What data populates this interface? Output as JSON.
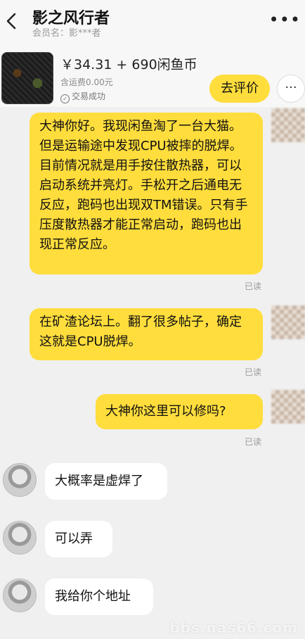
{
  "header": {
    "title": "影之风行者",
    "subtitle": "会员名：影***者"
  },
  "product": {
    "price": "￥34.31 + 690闲鱼币",
    "shipping": "含运费0.00元",
    "status": "交易成功",
    "review_label": "去评价",
    "more_label": "···"
  },
  "messages": [
    {
      "from": "me",
      "text": "大神你好。我现闲鱼淘了一台大猫。但是运输途中发现CPU被摔的脱焊。目前情况就是用手按住散热器，可以启动系统并亮灯。手松开之后通电无反应，跑码也出现双TM错误。只有手压度散热器才能正常启动，跑码也出现正常反应。",
      "read": "已读"
    },
    {
      "from": "me",
      "text": "在矿渣论坛上。翻了很多帖子，确定这就是CPU脱焊。",
      "read": "已读"
    },
    {
      "from": "me",
      "text": "大神你这里可以修吗?",
      "read": "已读"
    },
    {
      "from": "other",
      "text": "大概率是虚焊了"
    },
    {
      "from": "other",
      "text": "可以弄"
    },
    {
      "from": "other",
      "text": "我给你个地址"
    }
  ],
  "watermark": "bbs.nas66.com"
}
